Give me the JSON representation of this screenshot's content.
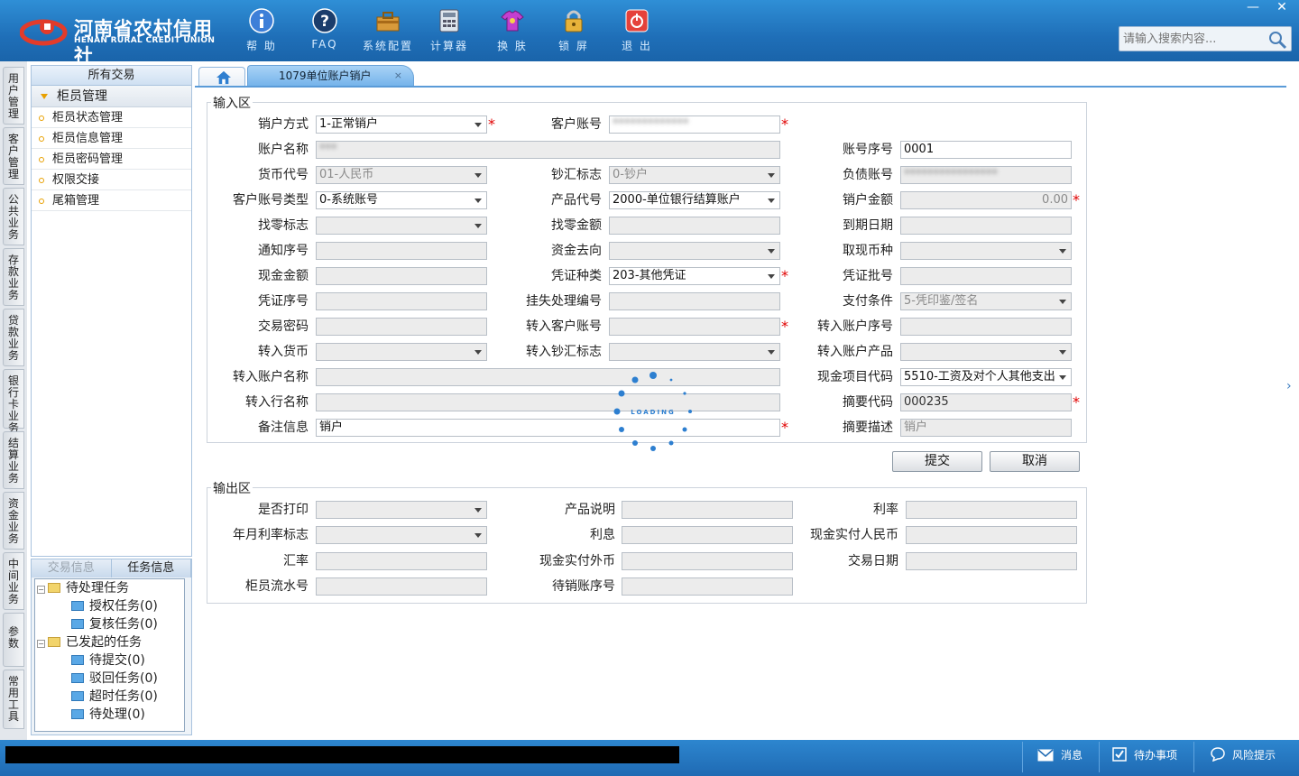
{
  "logo": {
    "cn": "河南省农村信用社",
    "en": "HENAN RURAL CREDIT UNION"
  },
  "toolbar": [
    {
      "label": "帮 助",
      "icon": "info-icon"
    },
    {
      "label": "FAQ",
      "icon": "help-icon"
    },
    {
      "label": "系统配置",
      "icon": "toolbox-icon"
    },
    {
      "label": "计算器",
      "icon": "calculator-icon"
    },
    {
      "label": "换 肤",
      "icon": "shirt-icon"
    },
    {
      "label": "锁 屏",
      "icon": "lock-icon"
    },
    {
      "label": "退 出",
      "icon": "power-icon"
    }
  ],
  "search": {
    "placeholder": "请输入搜索内容..."
  },
  "window": {
    "minimize": "—",
    "close": "✕"
  },
  "vtabs": [
    "用户管理",
    "客户管理",
    "公共业务",
    "存款业务",
    "贷款业务",
    "银行卡业务",
    "结算业务",
    "资金业务",
    "中间业务",
    "参数",
    "常用工具"
  ],
  "left_panel": {
    "header": "所有交易",
    "group": "柜员管理",
    "items": [
      "柜员状态管理",
      "柜员信息管理",
      "柜员密码管理",
      "权限交接",
      "尾箱管理"
    ]
  },
  "bottom_panel": {
    "tabs": [
      "交易信息",
      "任务信息"
    ],
    "tree": {
      "pending": "待处理任务",
      "pending_items": [
        "授权任务(0)",
        "复核任务(0)"
      ],
      "initiated": "已发起的任务",
      "initiated_items": [
        "待提交(0)",
        "驳回任务(0)",
        "超时任务(0)",
        "待处理(0)"
      ]
    }
  },
  "tab": {
    "active": "1079单位账户销户",
    "close": "×"
  },
  "input_section": {
    "legend": "输入区",
    "fields": {
      "close_method": {
        "label": "销户方式",
        "value": "1-正常销户"
      },
      "customer_account": {
        "label": "客户账号",
        "value": "*************"
      },
      "account_name": {
        "label": "账户名称",
        "value": "***"
      },
      "account_seq": {
        "label": "账号序号",
        "value": "0001"
      },
      "currency_code": {
        "label": "货币代号",
        "value": "01-人民币"
      },
      "cash_flag": {
        "label": "钞汇标志",
        "value": "0-钞户"
      },
      "debt_account": {
        "label": "负债账号",
        "value": "****************"
      },
      "account_type": {
        "label": "客户账号类型",
        "value": "0-系统账号"
      },
      "product_code": {
        "label": "产品代号",
        "value": "2000-单位银行结算账户"
      },
      "close_amount": {
        "label": "销户金额",
        "value": "0.00"
      },
      "change_flag": {
        "label": "找零标志",
        "value": ""
      },
      "change_amount": {
        "label": "找零金额",
        "value": ""
      },
      "due_date": {
        "label": "到期日期",
        "value": ""
      },
      "notice_seq": {
        "label": "通知序号",
        "value": ""
      },
      "fund_dest": {
        "label": "资金去向",
        "value": ""
      },
      "withdraw_currency": {
        "label": "取现币种",
        "value": ""
      },
      "cash_amount": {
        "label": "现金金额",
        "value": ""
      },
      "voucher_type": {
        "label": "凭证种类",
        "value": "203-其他凭证"
      },
      "voucher_batch": {
        "label": "凭证批号",
        "value": ""
      },
      "voucher_seq": {
        "label": "凭证序号",
        "value": ""
      },
      "loss_no": {
        "label": "挂失处理编号",
        "value": ""
      },
      "pay_cond": {
        "label": "支付条件",
        "value": "5-凭印鉴/签名"
      },
      "trade_pwd": {
        "label": "交易密码",
        "value": ""
      },
      "in_customer_account": {
        "label": "转入客户账号",
        "value": ""
      },
      "in_account_seq": {
        "label": "转入账户序号",
        "value": ""
      },
      "in_currency": {
        "label": "转入货币",
        "value": ""
      },
      "in_cash_flag": {
        "label": "转入钞汇标志",
        "value": ""
      },
      "in_account_product": {
        "label": "转入账户产品",
        "value": ""
      },
      "in_account_name": {
        "label": "转入账户名称",
        "value": ""
      },
      "cash_item_code": {
        "label": "现金项目代码",
        "value": "5510-工资及对个人其他支出"
      },
      "in_bank_name": {
        "label": "转入行名称",
        "value": ""
      },
      "summary_code": {
        "label": "摘要代码",
        "value": "000235"
      },
      "remark": {
        "label": "备注信息",
        "value": "销户"
      },
      "summary_desc": {
        "label": "摘要描述",
        "value": "销户"
      }
    }
  },
  "buttons": {
    "submit": "提交",
    "cancel": "取消"
  },
  "output_section": {
    "legend": "输出区",
    "fields": {
      "print": {
        "label": "是否打印"
      },
      "product_desc": {
        "label": "产品说明"
      },
      "rate": {
        "label": "利率"
      },
      "rate_flag": {
        "label": "年月利率标志"
      },
      "interest": {
        "label": "利息"
      },
      "cash_rmb": {
        "label": "现金实付人民币"
      },
      "exchange_rate": {
        "label": "汇率"
      },
      "cash_foreign": {
        "label": "现金实付外币"
      },
      "trade_date": {
        "label": "交易日期"
      },
      "teller_seq": {
        "label": "柜员流水号"
      },
      "pending_seq": {
        "label": "待销账序号"
      }
    }
  },
  "loading": {
    "text": "LOADING"
  },
  "statusbar": {
    "messages": "消息",
    "todo": "待办事项",
    "risk": "风险提示"
  },
  "colors": {
    "topbar": "#1f6fb8",
    "required": "#e00000",
    "accent": "#5a9bd8"
  }
}
